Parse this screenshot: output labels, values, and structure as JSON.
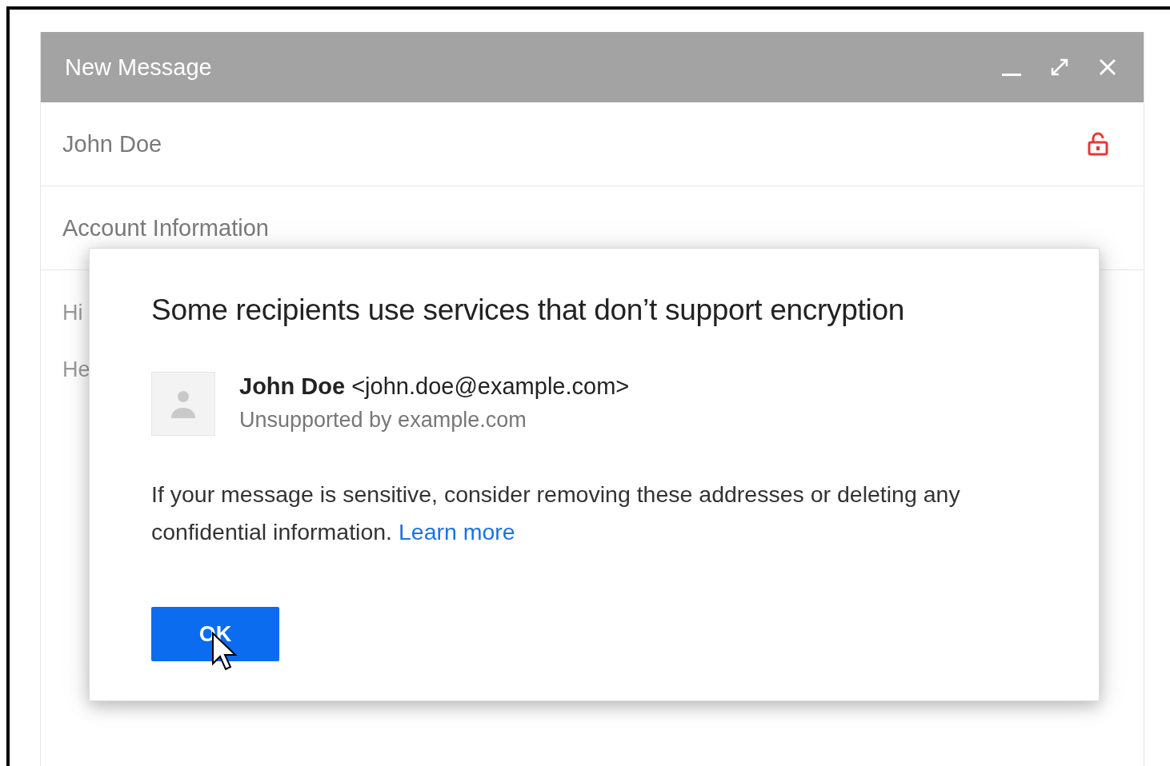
{
  "window": {
    "title": "New Message"
  },
  "fields": [
    {
      "value": "John Doe",
      "locked": false
    },
    {
      "value": "Account Information"
    }
  ],
  "body_lines": [
    "Hi",
    "He"
  ],
  "dialog": {
    "title": "Some recipients use services that don’t support encryption",
    "recipients": [
      {
        "name": "John Doe",
        "email": "<john.doe@example.com>",
        "note": "Unsupported by example.com"
      }
    ],
    "message": "If your message is sensitive, consider removing these addresses or deleting any confidential information.",
    "link": "Learn more",
    "button": "OK"
  }
}
